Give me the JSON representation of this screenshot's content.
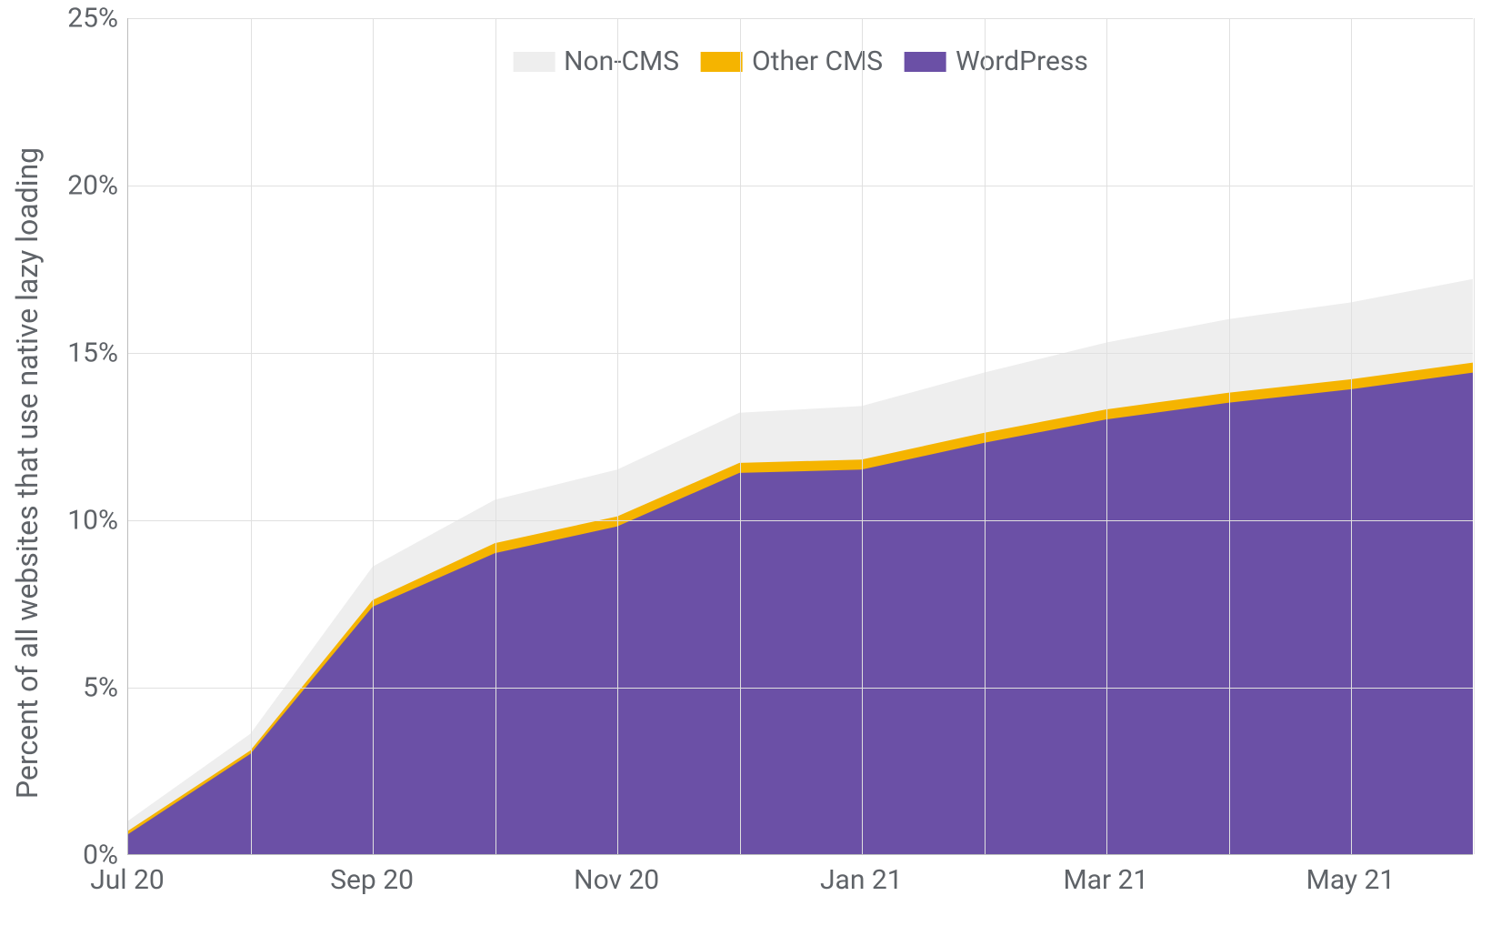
{
  "chart_data": {
    "type": "area",
    "ylabel": "Percent of all websites that use native lazy loading",
    "xlabel": "",
    "ylim": [
      0,
      25
    ],
    "y_ticks": [
      0,
      5,
      10,
      15,
      20,
      25
    ],
    "y_tick_labels": [
      "0%",
      "5%",
      "10%",
      "15%",
      "20%",
      "25%"
    ],
    "categories": [
      "Jul 20",
      "Aug 20",
      "Sep 20",
      "Oct 20",
      "Nov 20",
      "Dec 20",
      "Jan 21",
      "Feb 21",
      "Mar 21",
      "Apr 21",
      "May 21",
      "Jun 21"
    ],
    "x_tick_labels": [
      "Jul 20",
      "Sep 20",
      "Nov 20",
      "Jan 21",
      "Mar 21",
      "May 21"
    ],
    "x_tick_indices": [
      0,
      2,
      4,
      6,
      8,
      10
    ],
    "series": [
      {
        "name": "WordPress",
        "color": "#6b50a6",
        "values": [
          0.6,
          3.0,
          7.4,
          9.0,
          9.8,
          11.4,
          11.5,
          12.3,
          13.0,
          13.5,
          13.9,
          14.4
        ]
      },
      {
        "name": "Other CMS",
        "color": "#f5b400",
        "values": [
          0.1,
          0.1,
          0.2,
          0.3,
          0.3,
          0.3,
          0.3,
          0.3,
          0.3,
          0.3,
          0.3,
          0.3
        ]
      },
      {
        "name": "Non-CMS",
        "color": "#eeeeee",
        "values": [
          0.3,
          0.5,
          1.0,
          1.3,
          1.4,
          1.5,
          1.6,
          1.8,
          2.0,
          2.2,
          2.3,
          2.5
        ]
      }
    ],
    "legend_order": [
      "Non-CMS",
      "Other CMS",
      "WordPress"
    ],
    "legend_position": "top"
  }
}
